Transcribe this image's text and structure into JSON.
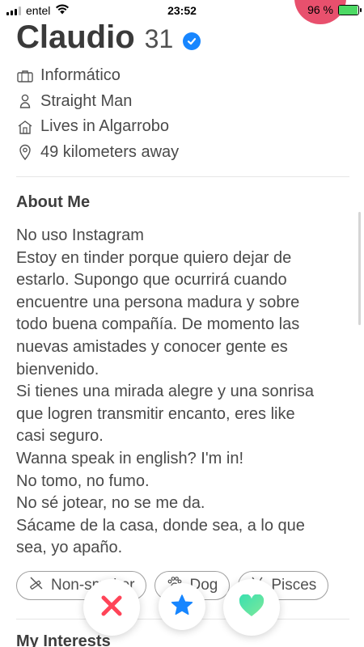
{
  "status_bar": {
    "carrier": "entel",
    "time": "23:52",
    "battery_percent": "96 %",
    "battery_level": 0.96
  },
  "profile": {
    "name": "Claudio",
    "age": "31",
    "verified_icon": "verified-badge-icon",
    "info": [
      {
        "icon": "briefcase-icon",
        "text": "Informático"
      },
      {
        "icon": "person-icon",
        "text": "Straight Man"
      },
      {
        "icon": "home-icon",
        "text": "Lives in Algarrobo"
      },
      {
        "icon": "location-pin-icon",
        "text": "49 kilometers away"
      }
    ]
  },
  "about": {
    "title": "About Me",
    "lines": [
      "No uso Instagram",
      "Estoy en tinder porque quiero dejar de",
      "estarlo. Supongo que ocurrirá cuando",
      "encuentre una persona madura y sobre",
      "todo buena compañía. De momento las",
      "nuevas amistades y conocer gente es",
      "bienvenido.",
      "Si tienes una mirada alegre y una sonrisa",
      "que logren transmitir encanto, eres like",
      "casi seguro.",
      "Wanna speak in english? I'm in!",
      "No tomo, no fumo.",
      "No sé jotear, no se me da.",
      "Sácame de la casa, donde sea, a lo que",
      "sea, yo apaño."
    ]
  },
  "chips": [
    {
      "icon": "no-smoking-icon",
      "label": "Non-smoker"
    },
    {
      "icon": "paw-icon",
      "label": "Dog"
    },
    {
      "icon": "zodiac-icon",
      "label": "Pisces"
    }
  ],
  "interests": {
    "title": "My Interests"
  },
  "actions": {
    "nope_icon": "close-icon",
    "superlike_icon": "star-icon",
    "like_icon": "heart-icon"
  },
  "colors": {
    "nope": "#ff4458",
    "superlike": "#1786ff",
    "like": "#4fe3a6",
    "brand": "#e8506d"
  }
}
